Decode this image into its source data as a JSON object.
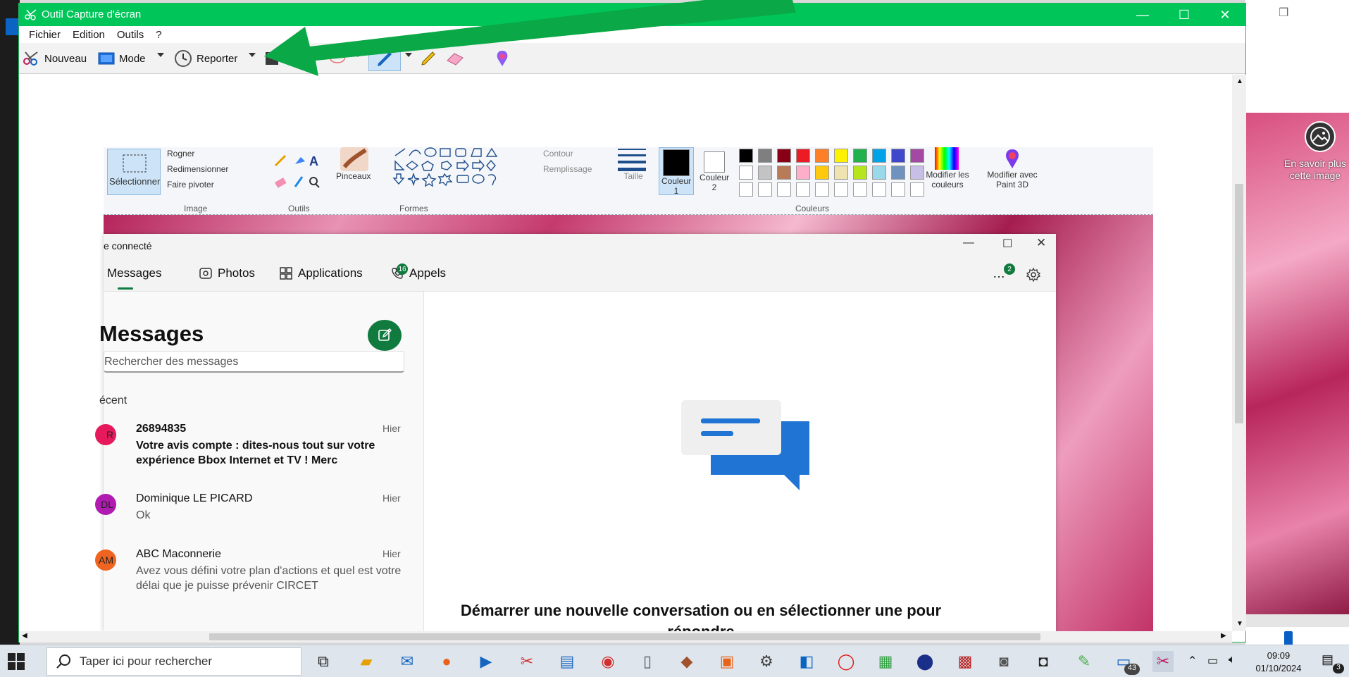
{
  "window": {
    "title": "Outil Capture d'écran"
  },
  "menu": [
    "Fichier",
    "Edition",
    "Outils",
    "?"
  ],
  "toolbar": {
    "new_label": "Nouveau",
    "mode_label": "Mode",
    "delay_label": "Reporter"
  },
  "ribbon": {
    "image_items": [
      "Rogner",
      "Redimensionner",
      "Faire pivoter"
    ],
    "select_label": "Sélectionner",
    "group_image": "Image",
    "group_tools": "Outils",
    "brushes_label": "Pinceaux",
    "group_shapes": "Formes",
    "outline_label": "Contour",
    "fill_label": "Remplissage",
    "size_label": "Taille",
    "color1_label": "Couleur 1",
    "color2_label": "Couleur 2",
    "group_colors": "Couleurs",
    "edit_colors_label": "Modifier les couleurs",
    "paint3d_label": "Modifier avec Paint 3D",
    "palette_row1": [
      "#000000",
      "#7f7f7f",
      "#880015",
      "#ed1c24",
      "#ff7f27",
      "#fff200",
      "#22b14c",
      "#00a2e8",
      "#3f48cc",
      "#a349a4"
    ],
    "palette_row2": [
      "#ffffff",
      "#c3c3c3",
      "#b97a57",
      "#ffaec9",
      "#ffc90e",
      "#efe4b0",
      "#b5e61d",
      "#99d9ea",
      "#7092be",
      "#c8bfe7"
    ]
  },
  "phone": {
    "title": "e connecté",
    "tabs": [
      {
        "label": "Messages"
      },
      {
        "label": "Photos"
      },
      {
        "label": "Applications"
      },
      {
        "label": "Appels",
        "badge": "16"
      }
    ],
    "more_badge": "2",
    "heading": "Messages",
    "search_placeholder": "Rechercher des messages",
    "recent_label": "écent",
    "conversations": [
      {
        "initials": "R",
        "name": "26894835",
        "time": "Hier",
        "preview": "Votre avis compte : dites-nous tout sur votre expérience Bbox Internet et TV ! Merc",
        "color": "#e6195d"
      },
      {
        "initials": "DL",
        "name": "Dominique LE PICARD",
        "time": "Hier",
        "preview": "Ok",
        "color": "#b01bb0"
      },
      {
        "initials": "AM",
        "name": "ABC Maconnerie",
        "time": "Hier",
        "preview": "Avez vous défini votre plan d'actions et quel est votre délai que je puisse prévenir CIRCET",
        "color": "#f06421"
      }
    ],
    "empty_state": "Démarrer une nouvelle conversation ou en sélectionner une pour répondre"
  },
  "desktop": {
    "info_text": "En savoir plus cette image"
  },
  "taskbar": {
    "search_placeholder": "Taper ici pour rechercher",
    "time": "09:09",
    "date": "01/10/2024",
    "badge_count": "43",
    "notif_count": "3"
  },
  "colors": {
    "accent_green": "#00c65a",
    "phone_green": "#117a3f",
    "arrow_green": "#0aa846"
  }
}
